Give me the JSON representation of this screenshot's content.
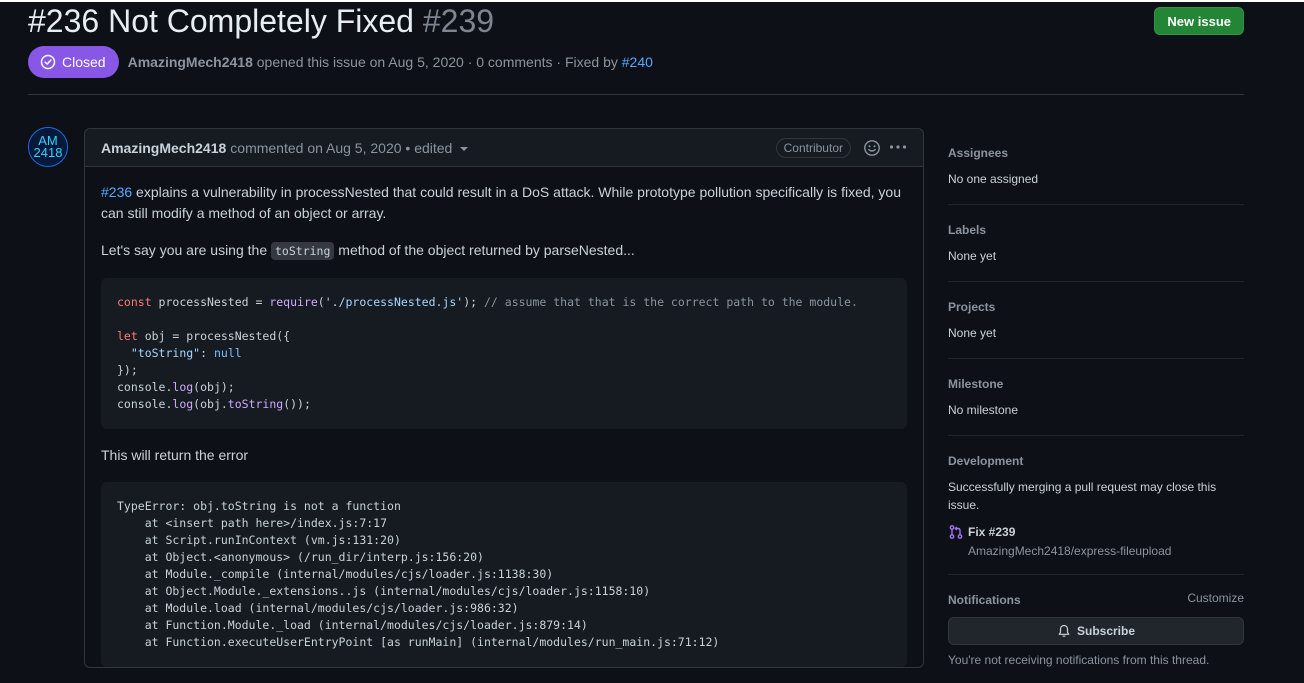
{
  "issue": {
    "title": "#236 Not Completely Fixed",
    "number": "#239",
    "new_issue_label": "New issue",
    "state_label": "Closed",
    "author": "AmazingMech2418",
    "opened_text": "opened this issue on Aug 5, 2020 · 0 comments · Fixed by",
    "fixed_by": "#240"
  },
  "comment": {
    "author": "AmazingMech2418",
    "meta": "commented on Aug 5, 2020 • edited",
    "role_badge": "Contributor",
    "avatar_text": "AM 2418",
    "p1_link": "#236",
    "p1_text": "explains a vulnerability in processNested that could result in a DoS attack. While prototype pollution specifically is fixed, you can still modify a method of an object or array.",
    "p2_pre": "Let's say you are using the",
    "p2_code": "toString",
    "p2_post": "method of the object returned by parseNested...",
    "p3": "This will return the error",
    "code1": {
      "kw_const": "const",
      "l1_a": " processNested = ",
      "fn_require": "require",
      "l1_b": "(",
      "str_path": "'./processNested.js'",
      "l1_c": "); ",
      "comment": "// assume that that is the correct path to the module.",
      "kw_let": "let",
      "l3": " obj = processNested({",
      "l4_indent": "  ",
      "str_key": "\"toString\"",
      "l4_colon": ": ",
      "cst_null": "null",
      "l5": "});",
      "l6_a": "console.",
      "fn_log": "log",
      "l6_b": "(obj);",
      "l7_a": "console.",
      "fn_log2": "log",
      "l7_b": "(obj.",
      "fn_tostring": "toString",
      "l7_c": "());"
    },
    "error_lines": [
      "TypeError: obj.toString is not a function",
      "    at <insert path here>/index.js:7:17",
      "    at Script.runInContext (vm.js:131:20)",
      "    at Object.<anonymous> (/run_dir/interp.js:156:20)",
      "    at Module._compile (internal/modules/cjs/loader.js:1138:30)",
      "    at Object.Module._extensions..js (internal/modules/cjs/loader.js:1158:10)",
      "    at Module.load (internal/modules/cjs/loader.js:986:32)",
      "    at Function.Module._load (internal/modules/cjs/loader.js:879:14)",
      "    at Function.executeUserEntryPoint [as runMain] (internal/modules/run_main.js:71:12)"
    ]
  },
  "sidebar": {
    "assignees_heading": "Assignees",
    "assignees_value": "No one assigned",
    "labels_heading": "Labels",
    "labels_value": "None yet",
    "projects_heading": "Projects",
    "projects_value": "None yet",
    "milestone_heading": "Milestone",
    "milestone_value": "No milestone",
    "development_heading": "Development",
    "development_value": "Successfully merging a pull request may close this issue.",
    "pr_title": "Fix #239",
    "pr_repo": "AmazingMech2418/express-fileupload",
    "notifications_heading": "Notifications",
    "customize_label": "Customize",
    "subscribe_label": "Subscribe",
    "subscribe_note": "You're not receiving notifications from this thread."
  },
  "colors": {
    "closed_badge": "#8957e5",
    "new_issue": "#238636",
    "link": "#58a6ff"
  },
  "icons": [
    "closed-check-icon",
    "smiley-icon",
    "kebab-icon",
    "git-pull-request-icon",
    "bell-icon",
    "caret-down-icon"
  ]
}
